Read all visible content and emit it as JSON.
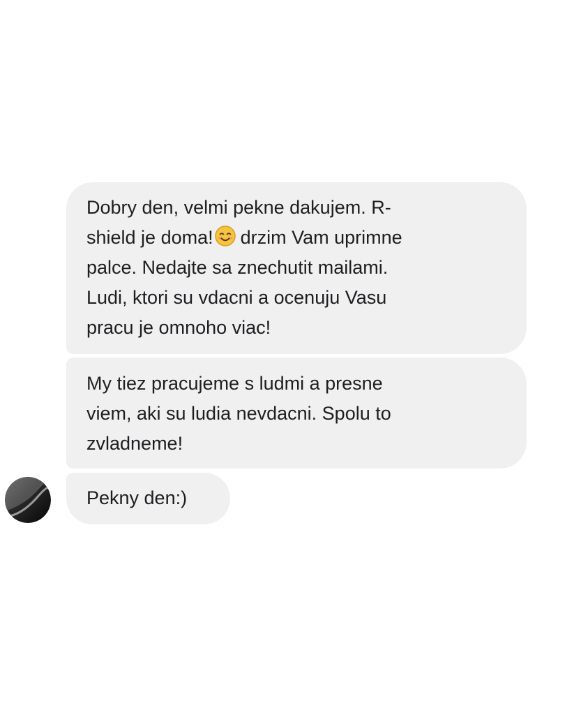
{
  "messages": [
    {
      "lines": [
        "Dobry den, velmi pekne dakujem. R-",
        "shield je doma!",
        "drzim Vam uprimne",
        "palce. Nedajte sa znechutit mailami.",
        "Ludi, ktori su vdacni a ocenuju Vasu",
        "pracu je omnoho viac!"
      ],
      "emoji": "smiling-face-emoji"
    },
    {
      "lines": [
        "My tiez pracujeme s ludmi a presne",
        "viem, aki su ludia nevdacni. Spolu to",
        "zvladneme!"
      ]
    },
    {
      "lines": [
        "Pekny den:)"
      ]
    }
  ],
  "colors": {
    "bubble_background": "#f1f0f0",
    "text": "#1c1e21",
    "page_background": "#ffffff"
  },
  "icons": {
    "avatar": "contact-avatar",
    "emoji": "smiling-face-emoji"
  }
}
